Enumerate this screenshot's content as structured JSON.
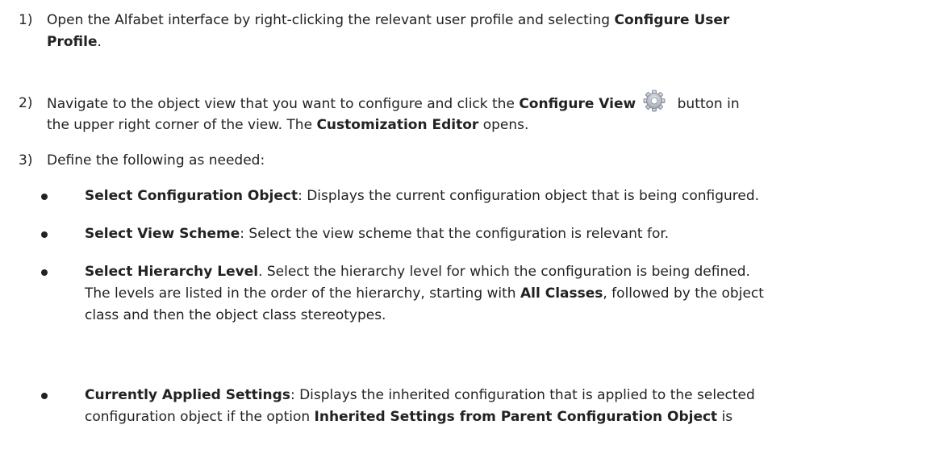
{
  "steps": [
    {
      "num": "1)",
      "line1_prefix": "Open the Alfabet interface by right-clicking the relevant user profile and selecting ",
      "line1_bold": "Configure User",
      "line2_bold": "Profile",
      "line2_suffix": "."
    },
    {
      "num": "2)",
      "prefix": "Navigate to the object view that you want to configure and click the ",
      "bold1": "Configure View",
      "mid": " button in",
      "line2_prefix": "the upper right corner of the view. The ",
      "bold2": "Customization Editor",
      "line2_suffix": " opens.",
      "icon": "gear-icon"
    },
    {
      "num": "3)",
      "text": "Define the following as needed:"
    }
  ],
  "bullets": [
    {
      "bold": "Select Configuration Object",
      "sep": ":",
      "text": " Displays the current configuration object that is being configured."
    },
    {
      "bold": "Select View Scheme",
      "sep": ":",
      "text": " Select the view scheme that the configuration is relevant for."
    },
    {
      "bold": "Select Hierarchy Level",
      "sep": ".",
      "line1": " Select the hierarchy level for which the configuration is being defined.",
      "line2_prefix": "The levels are listed in the order of the hierarchy, starting with ",
      "line2_bold": "All Classes",
      "line2_suffix": ", followed by the object",
      "line3": "class and then the object class stereotypes."
    },
    {
      "bold": "Currently Applied Settings",
      "sep": ":",
      "line1": " Displays the inherited configuration that is applied to the selected",
      "line2_prefix": "configuration object if the option ",
      "line2_bold": "Inherited Settings from Parent Configuration Object",
      "line2_suffix": " is"
    }
  ]
}
